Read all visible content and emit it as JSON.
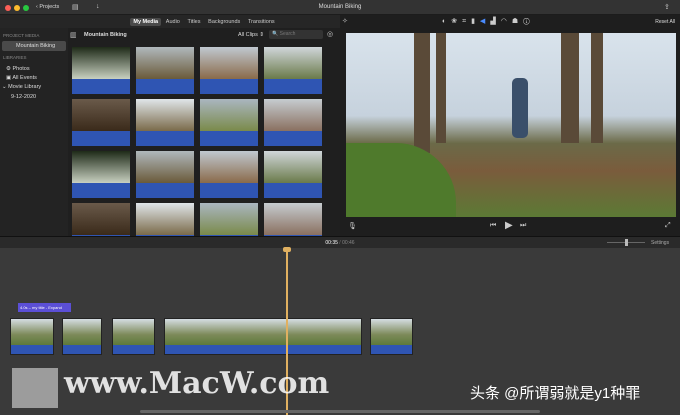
{
  "window": {
    "title": "Mountain Biking",
    "back_label": "Projects"
  },
  "browser_tabs": [
    "My Media",
    "Audio",
    "Titles",
    "Backgrounds",
    "Transitions"
  ],
  "sidebar": {
    "project_media_header": "PROJECT MEDIA",
    "project_item": "Mountain Biking",
    "libraries_header": "LIBRARIES",
    "items": [
      "Photos",
      "All Events",
      "Movie Library",
      "9-12-2020"
    ]
  },
  "browser": {
    "title": "Mountain Biking",
    "filter": "All Clips",
    "search_placeholder": "Search"
  },
  "viewer": {
    "reset_all": "Reset All"
  },
  "timeline": {
    "current_time": "00:35",
    "total_time": "00:46",
    "settings": "Settings",
    "title_clip": "4.0s – my title - Expand"
  },
  "watermarks": {
    "site": "www.MacW.com",
    "credit": "头条 @所谓弱就是y1种罪"
  },
  "colors": {
    "clip_blue": "#2f55b3",
    "playhead": "#e0b060",
    "title_purple": "#5b4fd6"
  }
}
